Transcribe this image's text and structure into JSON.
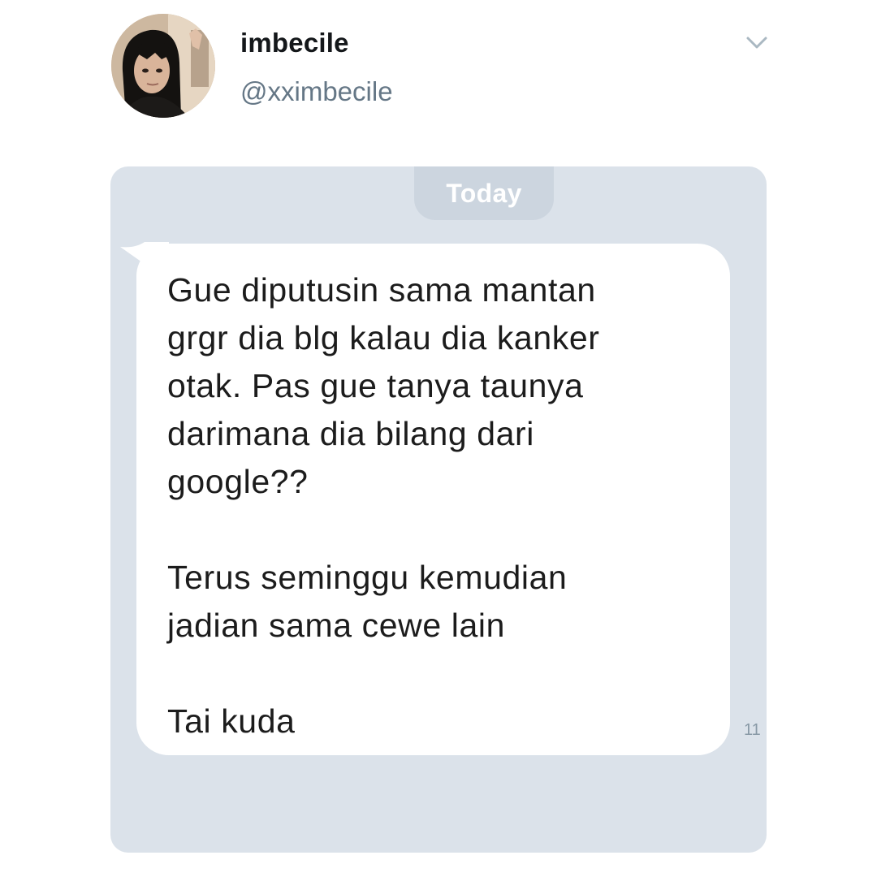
{
  "profile": {
    "display_name": "imbecile",
    "handle": "@xximbecile",
    "avatar_icon": "profile-photo",
    "menu_icon": "chevron-down-icon"
  },
  "conversation": {
    "date_label": "Today",
    "message": {
      "text": "Gue diputusin sama mantan\ngrgr dia blg kalau dia kanker\notak. Pas gue tanya taunya\ndarimana dia bilang dari\ngoogle??\n\nTerus seminggu kemudian\njadian sama cewe lain\n\nTai kuda",
      "timestamp": "11"
    }
  },
  "colors": {
    "panel_bg": "#dbe2ea",
    "pill_bg": "#ccd5df",
    "bubble_bg": "#ffffff",
    "handle": "#657786",
    "timestamp": "#8899a6"
  }
}
